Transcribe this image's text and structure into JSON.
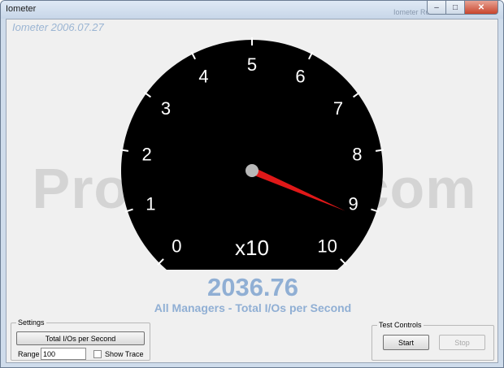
{
  "window": {
    "title": "Iometer",
    "ghost_title": "Iometer Ro...",
    "controls": {
      "minimize": "–",
      "maximize": "□",
      "close": "✕"
    }
  },
  "header": {
    "version": "Iometer 2006.07.27"
  },
  "watermark": "Programlar.com",
  "gauge": {
    "tick_labels": [
      "0",
      "1",
      "2",
      "3",
      "4",
      "5",
      "6",
      "7",
      "8",
      "9",
      "10"
    ],
    "multiplier": "x10",
    "min": 0,
    "max": 10,
    "multiplier_value": 10,
    "needle_value": 9.2,
    "dial_color": "#000000",
    "needle_color": "#e01818",
    "hub_color": "#b8b8b8"
  },
  "reading": {
    "value": "2036.76",
    "label": "All Managers - Total I/Os per Second"
  },
  "settings": {
    "legend": "Settings",
    "metric_button": "Total I/Os per Second",
    "range_label": "Range",
    "range_value": "100",
    "show_trace_label": "Show Trace",
    "show_trace_checked": false
  },
  "test_controls": {
    "legend": "Test Controls",
    "start": "Start",
    "stop": "Stop"
  }
}
